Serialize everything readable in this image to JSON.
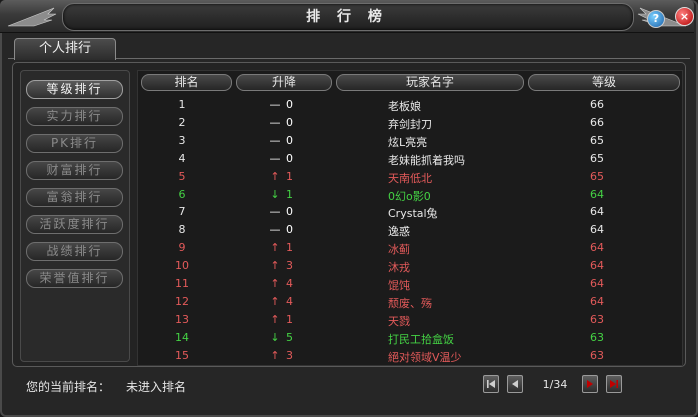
{
  "window": {
    "title": "排 行 榜",
    "help_label": "?",
    "close_label": "×"
  },
  "tabs": [
    {
      "label": "个人排行"
    }
  ],
  "categories": [
    {
      "label": "等级排行",
      "active": true
    },
    {
      "label": "实力排行",
      "active": false
    },
    {
      "label": "PK排行",
      "active": false
    },
    {
      "label": "财富排行",
      "active": false
    },
    {
      "label": "富翁排行",
      "active": false
    },
    {
      "label": "活跃度排行",
      "active": false
    },
    {
      "label": "战绩排行",
      "active": false
    },
    {
      "label": "荣誉值排行",
      "active": false
    }
  ],
  "table": {
    "headers": {
      "rank": "排名",
      "change": "升降",
      "name": "玩家名字",
      "level": "等级"
    },
    "rows": [
      {
        "rank": "1",
        "trend": "flat",
        "delta": "0",
        "name": "老板娘",
        "level": "66",
        "color": "#e8e8e8"
      },
      {
        "rank": "2",
        "trend": "flat",
        "delta": "0",
        "name": "弃剑封刀",
        "level": "66",
        "color": "#e8e8e8"
      },
      {
        "rank": "3",
        "trend": "flat",
        "delta": "0",
        "name": "炫L亮亮",
        "level": "65",
        "color": "#e8e8e8"
      },
      {
        "rank": "4",
        "trend": "flat",
        "delta": "0",
        "name": "老妹能抓着我吗",
        "level": "65",
        "color": "#e8e8e8"
      },
      {
        "rank": "5",
        "trend": "up",
        "delta": "1",
        "name": "天南低北",
        "level": "65",
        "color": "#e35a5a"
      },
      {
        "rank": "6",
        "trend": "down",
        "delta": "1",
        "name": "0幻o影0",
        "level": "64",
        "color": "#44d244"
      },
      {
        "rank": "7",
        "trend": "flat",
        "delta": "0",
        "name": "Crystal兔",
        "level": "64",
        "color": "#e8e8e8"
      },
      {
        "rank": "8",
        "trend": "flat",
        "delta": "0",
        "name": "逸惑",
        "level": "64",
        "color": "#e8e8e8"
      },
      {
        "rank": "9",
        "trend": "up",
        "delta": "1",
        "name": "冰蓟",
        "level": "64",
        "color": "#e35a5a"
      },
      {
        "rank": "10",
        "trend": "up",
        "delta": "3",
        "name": "沐戎",
        "level": "64",
        "color": "#e35a5a"
      },
      {
        "rank": "11",
        "trend": "up",
        "delta": "4",
        "name": "馄饨",
        "level": "64",
        "color": "#e35a5a"
      },
      {
        "rank": "12",
        "trend": "up",
        "delta": "4",
        "name": "颓废、殇",
        "level": "64",
        "color": "#e35a5a"
      },
      {
        "rank": "13",
        "trend": "up",
        "delta": "1",
        "name": "天戮",
        "level": "63",
        "color": "#e35a5a"
      },
      {
        "rank": "14",
        "trend": "down",
        "delta": "5",
        "name": "打民工拾盒饭",
        "level": "63",
        "color": "#44d244"
      },
      {
        "rank": "15",
        "trend": "up",
        "delta": "3",
        "name": "絕对领域V温少",
        "level": "63",
        "color": "#e35a5a"
      }
    ]
  },
  "footer": {
    "current_rank_label": "您的当前排名：",
    "current_rank_value": "未进入排名",
    "page_indicator": "1/34"
  },
  "colors": {
    "up": "#e35a5a",
    "down": "#44d244",
    "flat": "#e8e8e8",
    "accent_red": "#b00000"
  }
}
